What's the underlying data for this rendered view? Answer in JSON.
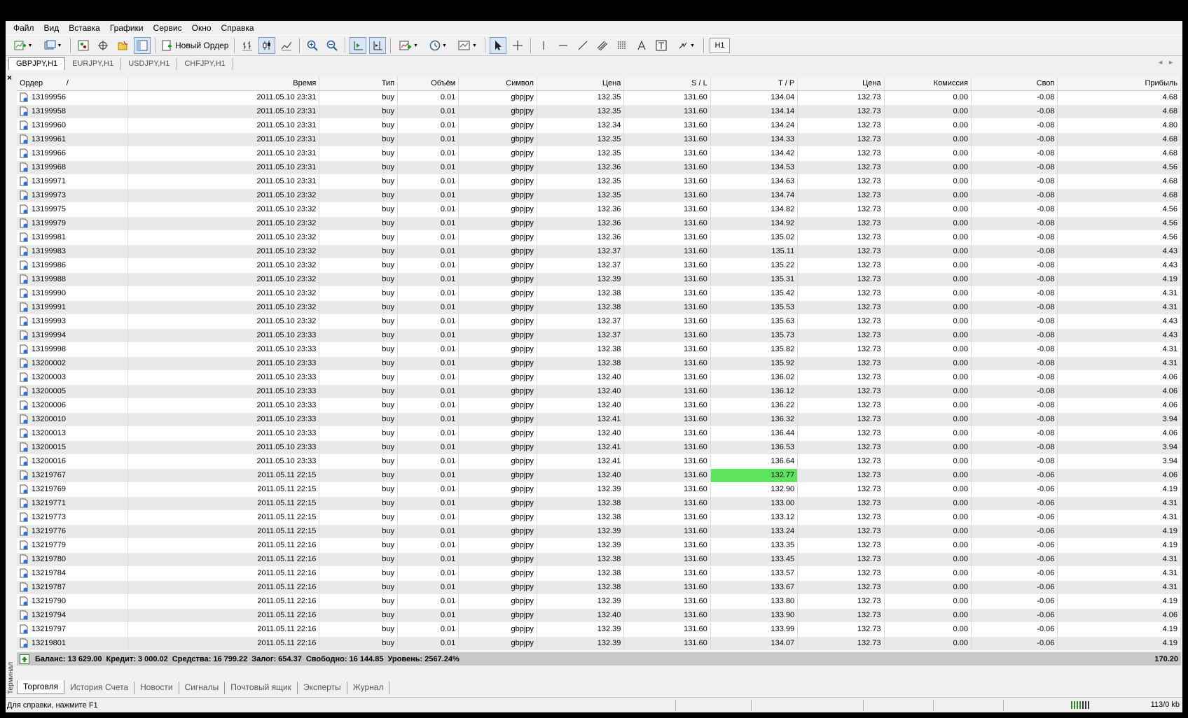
{
  "menu": [
    "Файл",
    "Вид",
    "Вставка",
    "Графики",
    "Сервис",
    "Окно",
    "Справка"
  ],
  "toolbar": {
    "new_order_label": "Новый Ордер",
    "timeframe_label": "H1"
  },
  "chart_tabs": [
    "GBPJPY,H1",
    "EURJPY,H1",
    "USDJPY,H1",
    "CHFJPY,H1"
  ],
  "columns": [
    "Ордер",
    "Время",
    "Тип",
    "Объём",
    "Символ",
    "Цена",
    "S / L",
    "T / P",
    "Цена",
    "Комиссия",
    "Своп",
    "Прибыль"
  ],
  "sort_indicator": "/",
  "close_label": "×",
  "terminal_label": "Терминал",
  "orders": [
    [
      "13199956",
      "2011.05.10 23:31",
      "buy",
      "0.01",
      "gbpjpy",
      "132.35",
      "131.60",
      "134.04",
      "132.73",
      "0.00",
      "-0.08",
      "4.68"
    ],
    [
      "13199958",
      "2011.05.10 23:31",
      "buy",
      "0.01",
      "gbpjpy",
      "132.35",
      "131.60",
      "134.14",
      "132.73",
      "0.00",
      "-0.08",
      "4.68"
    ],
    [
      "13199960",
      "2011.05.10 23:31",
      "buy",
      "0.01",
      "gbpjpy",
      "132.34",
      "131.60",
      "134.24",
      "132.73",
      "0.00",
      "-0.08",
      "4.80"
    ],
    [
      "13199961",
      "2011.05.10 23:31",
      "buy",
      "0.01",
      "gbpjpy",
      "132.35",
      "131.60",
      "134.33",
      "132.73",
      "0.00",
      "-0.08",
      "4.68"
    ],
    [
      "13199966",
      "2011.05.10 23:31",
      "buy",
      "0.01",
      "gbpjpy",
      "132.35",
      "131.60",
      "134.42",
      "132.73",
      "0.00",
      "-0.08",
      "4.68"
    ],
    [
      "13199968",
      "2011.05.10 23:31",
      "buy",
      "0.01",
      "gbpjpy",
      "132.36",
      "131.60",
      "134.53",
      "132.73",
      "0.00",
      "-0.08",
      "4.56"
    ],
    [
      "13199971",
      "2011.05.10 23:31",
      "buy",
      "0.01",
      "gbpjpy",
      "132.35",
      "131.60",
      "134.63",
      "132.73",
      "0.00",
      "-0.08",
      "4.68"
    ],
    [
      "13199973",
      "2011.05.10 23:32",
      "buy",
      "0.01",
      "gbpjpy",
      "132.35",
      "131.60",
      "134.74",
      "132.73",
      "0.00",
      "-0.08",
      "4.68"
    ],
    [
      "13199975",
      "2011.05.10 23:32",
      "buy",
      "0.01",
      "gbpjpy",
      "132.36",
      "131.60",
      "134.82",
      "132.73",
      "0.00",
      "-0.08",
      "4.56"
    ],
    [
      "13199979",
      "2011.05.10 23:32",
      "buy",
      "0.01",
      "gbpjpy",
      "132.36",
      "131.60",
      "134.92",
      "132.73",
      "0.00",
      "-0.08",
      "4.56"
    ],
    [
      "13199981",
      "2011.05.10 23:32",
      "buy",
      "0.01",
      "gbpjpy",
      "132.36",
      "131.60",
      "135.02",
      "132.73",
      "0.00",
      "-0.08",
      "4.56"
    ],
    [
      "13199983",
      "2011.05.10 23:32",
      "buy",
      "0.01",
      "gbpjpy",
      "132.37",
      "131.60",
      "135.11",
      "132.73",
      "0.00",
      "-0.08",
      "4.43"
    ],
    [
      "13199986",
      "2011.05.10 23:32",
      "buy",
      "0.01",
      "gbpjpy",
      "132.37",
      "131.60",
      "135.22",
      "132.73",
      "0.00",
      "-0.08",
      "4.43"
    ],
    [
      "13199988",
      "2011.05.10 23:32",
      "buy",
      "0.01",
      "gbpjpy",
      "132.39",
      "131.60",
      "135.31",
      "132.73",
      "0.00",
      "-0.08",
      "4.19"
    ],
    [
      "13199990",
      "2011.05.10 23:32",
      "buy",
      "0.01",
      "gbpjpy",
      "132.38",
      "131.60",
      "135.42",
      "132.73",
      "0.00",
      "-0.08",
      "4.31"
    ],
    [
      "13199991",
      "2011.05.10 23:32",
      "buy",
      "0.01",
      "gbpjpy",
      "132.38",
      "131.60",
      "135.53",
      "132.73",
      "0.00",
      "-0.08",
      "4.31"
    ],
    [
      "13199993",
      "2011.05.10 23:32",
      "buy",
      "0.01",
      "gbpjpy",
      "132.37",
      "131.60",
      "135.63",
      "132.73",
      "0.00",
      "-0.08",
      "4.43"
    ],
    [
      "13199994",
      "2011.05.10 23:33",
      "buy",
      "0.01",
      "gbpjpy",
      "132.37",
      "131.60",
      "135.73",
      "132.73",
      "0.00",
      "-0.08",
      "4.43"
    ],
    [
      "13199998",
      "2011.05.10 23:33",
      "buy",
      "0.01",
      "gbpjpy",
      "132.38",
      "131.60",
      "135.82",
      "132.73",
      "0.00",
      "-0.08",
      "4.31"
    ],
    [
      "13200002",
      "2011.05.10 23:33",
      "buy",
      "0.01",
      "gbpjpy",
      "132.38",
      "131.60",
      "135.92",
      "132.73",
      "0.00",
      "-0.08",
      "4.31"
    ],
    [
      "13200003",
      "2011.05.10 23:33",
      "buy",
      "0.01",
      "gbpjpy",
      "132.40",
      "131.60",
      "136.02",
      "132.73",
      "0.00",
      "-0.08",
      "4.06"
    ],
    [
      "13200005",
      "2011.05.10 23:33",
      "buy",
      "0.01",
      "gbpjpy",
      "132.40",
      "131.60",
      "136.12",
      "132.73",
      "0.00",
      "-0.08",
      "4.06"
    ],
    [
      "13200006",
      "2011.05.10 23:33",
      "buy",
      "0.01",
      "gbpjpy",
      "132.40",
      "131.60",
      "136.22",
      "132.73",
      "0.00",
      "-0.08",
      "4.06"
    ],
    [
      "13200010",
      "2011.05.10 23:33",
      "buy",
      "0.01",
      "gbpjpy",
      "132.41",
      "131.60",
      "136.32",
      "132.73",
      "0.00",
      "-0.08",
      "3.94"
    ],
    [
      "13200013",
      "2011.05.10 23:33",
      "buy",
      "0.01",
      "gbpjpy",
      "132.40",
      "131.60",
      "136.44",
      "132.73",
      "0.00",
      "-0.08",
      "4.06"
    ],
    [
      "13200015",
      "2011.05.10 23:33",
      "buy",
      "0.01",
      "gbpjpy",
      "132.41",
      "131.60",
      "136.53",
      "132.73",
      "0.00",
      "-0.08",
      "3.94"
    ],
    [
      "13200016",
      "2011.05.10 23:33",
      "buy",
      "0.01",
      "gbpjpy",
      "132.41",
      "131.60",
      "136.64",
      "132.73",
      "0.00",
      "-0.08",
      "3.94"
    ],
    [
      "13219767",
      "2011.05.11 22:15",
      "buy",
      "0.01",
      "gbpjpy",
      "132.40",
      "131.60",
      "132.77",
      "132.73",
      "0.00",
      "-0.06",
      "4.06"
    ],
    [
      "13219769",
      "2011.05.11 22:15",
      "buy",
      "0.01",
      "gbpjpy",
      "132.39",
      "131.60",
      "132.90",
      "132.73",
      "0.00",
      "-0.06",
      "4.19"
    ],
    [
      "13219771",
      "2011.05.11 22:15",
      "buy",
      "0.01",
      "gbpjpy",
      "132.38",
      "131.60",
      "133.00",
      "132.73",
      "0.00",
      "-0.06",
      "4.31"
    ],
    [
      "13219773",
      "2011.05.11 22:15",
      "buy",
      "0.01",
      "gbpjpy",
      "132.38",
      "131.60",
      "133.12",
      "132.73",
      "0.00",
      "-0.06",
      "4.31"
    ],
    [
      "13219776",
      "2011.05.11 22:15",
      "buy",
      "0.01",
      "gbpjpy",
      "132.39",
      "131.60",
      "133.24",
      "132.73",
      "0.00",
      "-0.06",
      "4.19"
    ],
    [
      "13219779",
      "2011.05.11 22:16",
      "buy",
      "0.01",
      "gbpjpy",
      "132.39",
      "131.60",
      "133.35",
      "132.73",
      "0.00",
      "-0.06",
      "4.19"
    ],
    [
      "13219780",
      "2011.05.11 22:16",
      "buy",
      "0.01",
      "gbpjpy",
      "132.38",
      "131.60",
      "133.45",
      "132.73",
      "0.00",
      "-0.06",
      "4.31"
    ],
    [
      "13219784",
      "2011.05.11 22:16",
      "buy",
      "0.01",
      "gbpjpy",
      "132.38",
      "131.60",
      "133.57",
      "132.73",
      "0.00",
      "-0.06",
      "4.31"
    ],
    [
      "13219787",
      "2011.05.11 22:16",
      "buy",
      "0.01",
      "gbpjpy",
      "132.38",
      "131.60",
      "133.67",
      "132.73",
      "0.00",
      "-0.06",
      "4.31"
    ],
    [
      "13219790",
      "2011.05.11 22:16",
      "buy",
      "0.01",
      "gbpjpy",
      "132.39",
      "131.60",
      "133.80",
      "132.73",
      "0.00",
      "-0.06",
      "4.19"
    ],
    [
      "13219794",
      "2011.05.11 22:16",
      "buy",
      "0.01",
      "gbpjpy",
      "132.40",
      "131.60",
      "133.90",
      "132.73",
      "0.00",
      "-0.06",
      "4.06"
    ],
    [
      "13219797",
      "2011.05.11 22:16",
      "buy",
      "0.01",
      "gbpjpy",
      "132.39",
      "131.60",
      "133.99",
      "132.73",
      "0.00",
      "-0.06",
      "4.19"
    ],
    [
      "13219801",
      "2011.05.11 22:16",
      "buy",
      "0.01",
      "gbpjpy",
      "132.39",
      "131.60",
      "134.07",
      "132.73",
      "0.00",
      "-0.06",
      "4.19"
    ]
  ],
  "highlight": {
    "order": "13219767",
    "column": "T / P",
    "color": "#5de35d"
  },
  "summary": {
    "balance": "Баланс: 13 629.00",
    "credit": "Кредит: 3 000.02",
    "equity": "Средства: 16 799.22",
    "margin": "Залог: 654.37",
    "free": "Свободно: 16 144.85",
    "level": "Уровень: 2567.24%",
    "total_profit": "170.20"
  },
  "bottom_tabs": [
    "Торговля",
    "История Счета",
    "Новости",
    "Сигналы",
    "Почтовый ящик",
    "Эксперты",
    "Журнал"
  ],
  "status": {
    "help": "Для справки, нажмите F1",
    "traffic": "113/0 kb"
  }
}
